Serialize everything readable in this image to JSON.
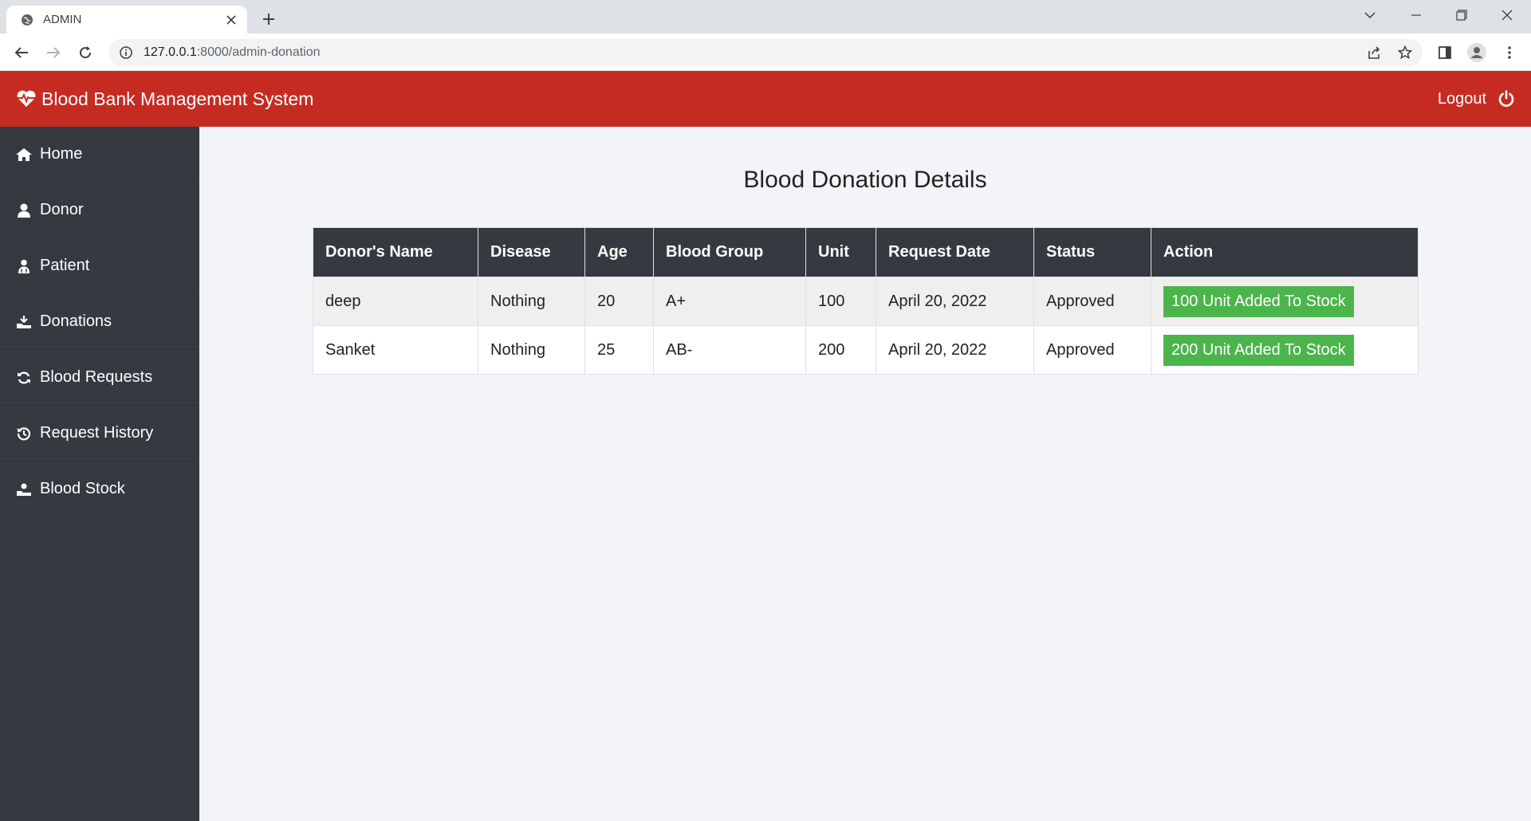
{
  "browser": {
    "tab_title": "ADMIN",
    "url_host": "127.0.0.1",
    "url_rest": ":8000/admin-donation"
  },
  "header": {
    "brand": "Blood Bank Management System",
    "logout_label": "Logout",
    "bg_color": "#c62b22"
  },
  "sidebar": {
    "items": [
      {
        "label": "Home",
        "icon": "home-icon"
      },
      {
        "label": "Donor",
        "icon": "user-icon"
      },
      {
        "label": "Patient",
        "icon": "patient-icon"
      },
      {
        "label": "Donations",
        "icon": "donation-icon"
      },
      {
        "label": "Blood Requests",
        "icon": "refresh-icon"
      },
      {
        "label": "Request History",
        "icon": "history-icon"
      },
      {
        "label": "Blood Stock",
        "icon": "stock-icon"
      }
    ]
  },
  "main": {
    "title": "Blood Donation Details",
    "columns": [
      "Donor's Name",
      "Disease",
      "Age",
      "Blood Group",
      "Unit",
      "Request Date",
      "Status",
      "Action"
    ],
    "rows": [
      {
        "name": "deep",
        "disease": "Nothing",
        "age": "20",
        "blood_group": "A+",
        "unit": "100",
        "date": "April 20, 2022",
        "status": "Approved",
        "action": "100 Unit Added To Stock"
      },
      {
        "name": "Sanket",
        "disease": "Nothing",
        "age": "25",
        "blood_group": "AB-",
        "unit": "200",
        "date": "April 20, 2022",
        "status": "Approved",
        "action": "200 Unit Added To Stock"
      }
    ]
  }
}
